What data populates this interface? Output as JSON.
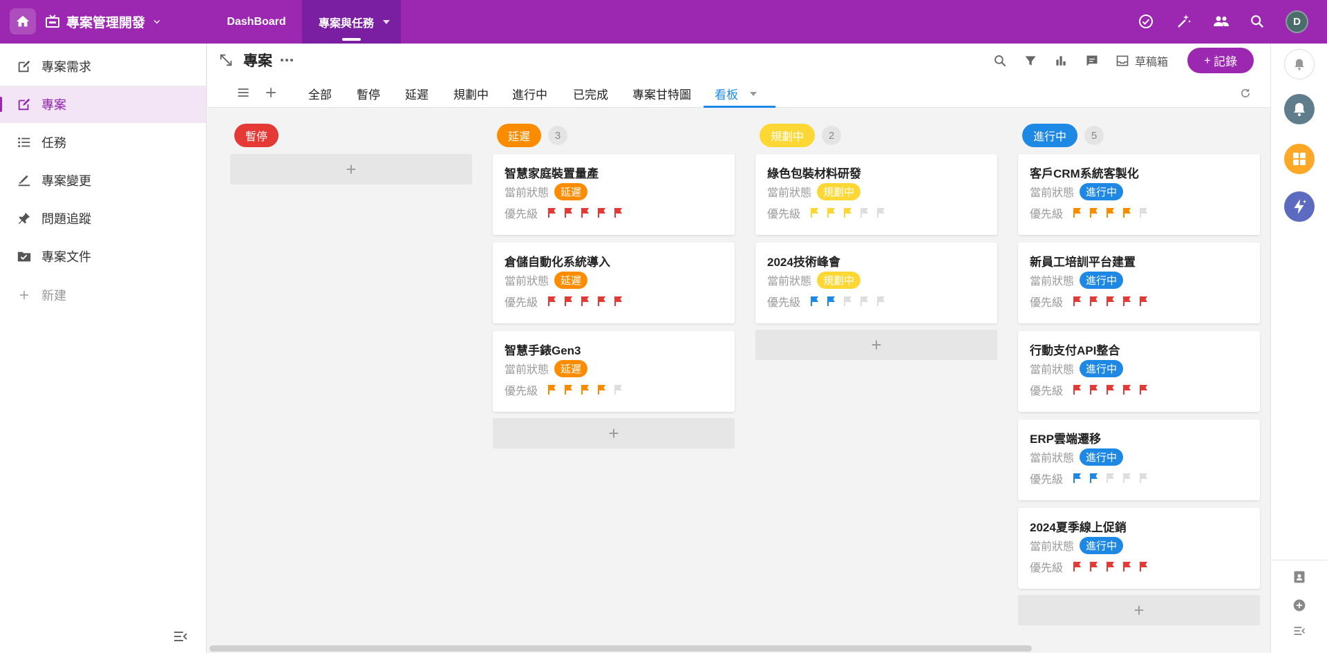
{
  "topbar": {
    "app_title": "專案管理開發",
    "nav_tabs": [
      "DashBoard",
      "專案與任務"
    ],
    "avatar_initial": "D",
    "color": "#9c27b0"
  },
  "sidebar": {
    "items": [
      {
        "label": "專案需求",
        "icon": "edit-square-icon"
      },
      {
        "label": "專案",
        "icon": "edit-square-icon"
      },
      {
        "label": "任務",
        "icon": "list-icon"
      },
      {
        "label": "專案變更",
        "icon": "sign-icon"
      },
      {
        "label": "問題追蹤",
        "icon": "pin-icon"
      },
      {
        "label": "專案文件",
        "icon": "folder-check-icon"
      },
      {
        "label": "新建",
        "icon": "plus-icon"
      }
    ],
    "active_index": 1
  },
  "header": {
    "title": "專案",
    "draft_label": "草稿箱",
    "record_button": "記錄"
  },
  "view_tabs": [
    "全部",
    "暫停",
    "延遲",
    "規劃中",
    "進行中",
    "已完成",
    "專案甘特圖",
    "看板"
  ],
  "active_view": "看板",
  "board": {
    "columns": [
      {
        "name": "暫停",
        "color": "#e53935",
        "count": "",
        "cards": []
      },
      {
        "name": "延遲",
        "color": "#fb8c00",
        "count": "3",
        "cards": [
          {
            "title": "智慧家庭裝置量產",
            "status_label": "當前狀態",
            "status": "延遲",
            "priority_label": "優先級",
            "priority": 5,
            "flag_color": "#e53935"
          },
          {
            "title": "倉儲自動化系統導入",
            "status_label": "當前狀態",
            "status": "延遲",
            "priority_label": "優先級",
            "priority": 5,
            "flag_color": "#e53935"
          },
          {
            "title": "智慧手錶Gen3",
            "status_label": "當前狀態",
            "status": "延遲",
            "priority_label": "優先級",
            "priority": 4,
            "flag_color": "#fb8c00"
          }
        ]
      },
      {
        "name": "規劃中",
        "color": "#fdd835",
        "count": "2",
        "cards": [
          {
            "title": "綠色包裝材料研發",
            "status_label": "當前狀態",
            "status": "規劃中",
            "priority_label": "優先級",
            "priority": 3,
            "flag_color": "#fdd835"
          },
          {
            "title": "2024技術峰會",
            "status_label": "當前狀態",
            "status": "規劃中",
            "priority_label": "優先級",
            "priority": 2,
            "flag_color": "#1e88e5"
          }
        ]
      },
      {
        "name": "進行中",
        "color": "#1e88e5",
        "count": "5",
        "cards": [
          {
            "title": "客戶CRM系統客製化",
            "status_label": "當前狀態",
            "status": "進行中",
            "priority_label": "優先級",
            "priority": 4,
            "flag_color": "#fb8c00"
          },
          {
            "title": "新員工培訓平台建置",
            "status_label": "當前狀態",
            "status": "進行中",
            "priority_label": "優先級",
            "priority": 5,
            "flag_color": "#e53935"
          },
          {
            "title": "行動支付API整合",
            "status_label": "當前狀態",
            "status": "進行中",
            "priority_label": "優先級",
            "priority": 5,
            "flag_color": "#e53935"
          },
          {
            "title": "ERP雲端遷移",
            "status_label": "當前狀態",
            "status": "進行中",
            "priority_label": "優先級",
            "priority": 2,
            "flag_color": "#1e88e5"
          },
          {
            "title": "2024夏季線上促銷",
            "status_label": "當前狀態",
            "status": "進行中",
            "priority_label": "優先級",
            "priority": 5,
            "flag_color": "#e53935"
          }
        ]
      }
    ]
  }
}
